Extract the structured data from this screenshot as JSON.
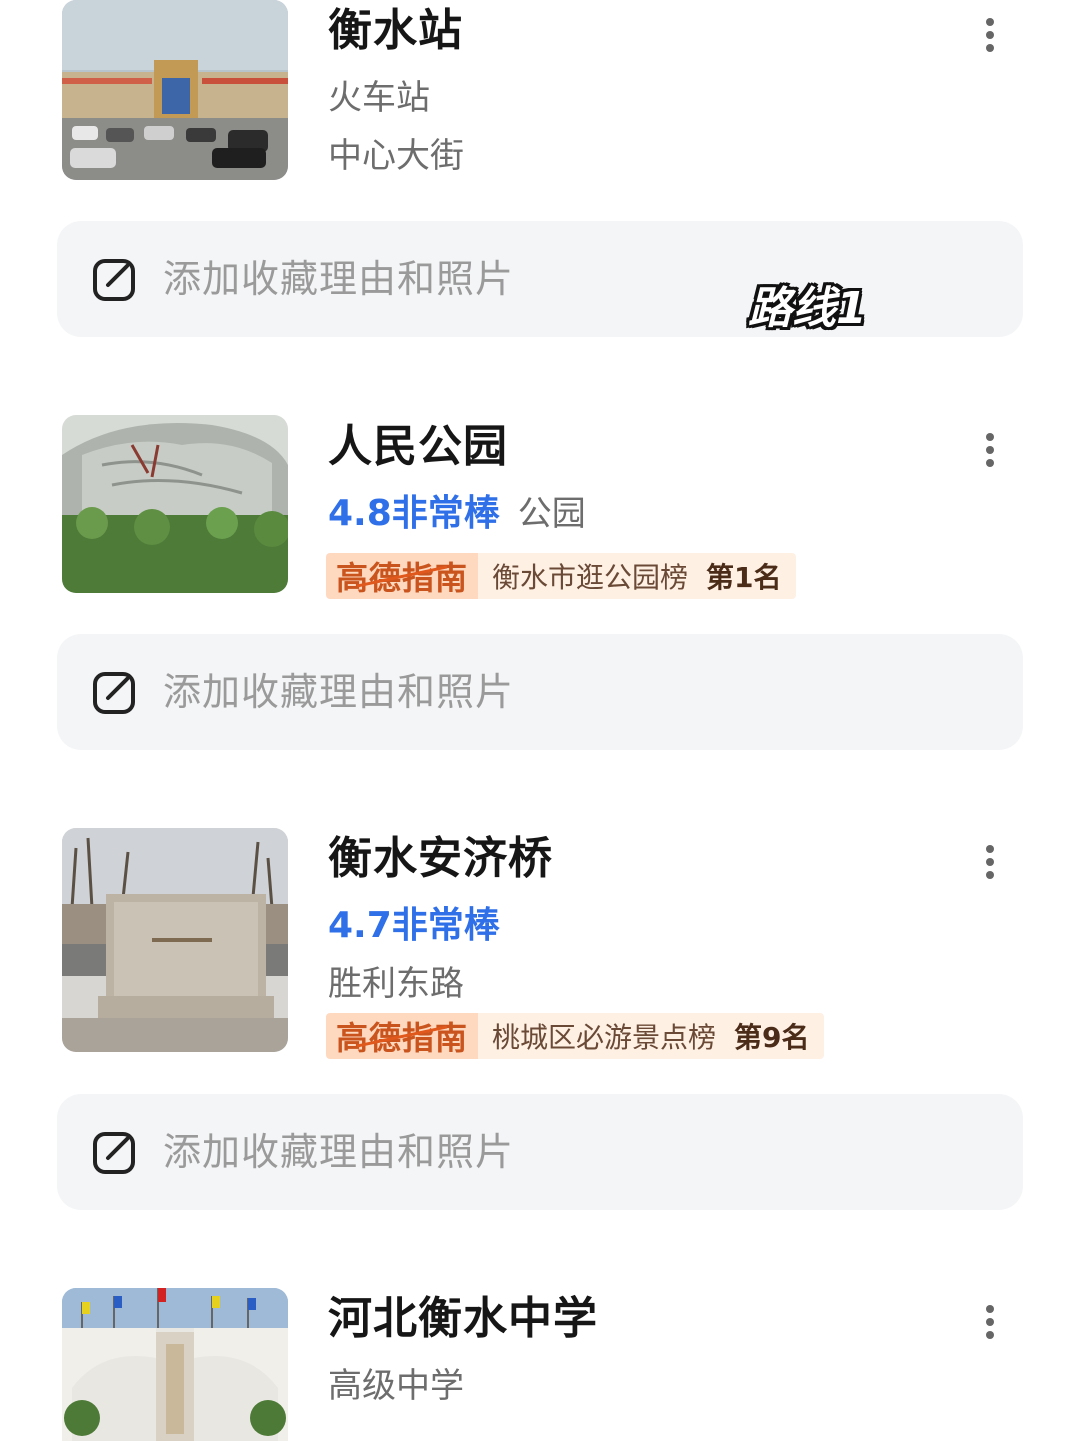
{
  "places": [
    {
      "name": "衡水站",
      "category": "火车站",
      "address": "中心大街",
      "note_label": "添加收藏理由和照片"
    },
    {
      "name": "人民公园",
      "rating": "4.8非常棒",
      "category": "公园",
      "guide": {
        "brand": "高德指南",
        "list": "衡水市逛公园榜",
        "rank": "第1名"
      },
      "note_label": "添加收藏理由和照片"
    },
    {
      "name": "衡水安济桥",
      "rating": "4.7非常棒",
      "address": "胜利东路",
      "guide": {
        "brand": "高德指南",
        "list": "桃城区必游景点榜",
        "rank": "第9名"
      },
      "note_label": "添加收藏理由和照片"
    },
    {
      "name": "河北衡水中学",
      "category": "高级中学"
    }
  ],
  "overlay_label": "路线1",
  "icons": {
    "more": "more-vertical-icon",
    "edit": "edit-note-icon"
  },
  "colors": {
    "rating_blue": "#2f6fe8",
    "guide_orange": "#c9541e",
    "note_bg": "#f4f5f7"
  }
}
